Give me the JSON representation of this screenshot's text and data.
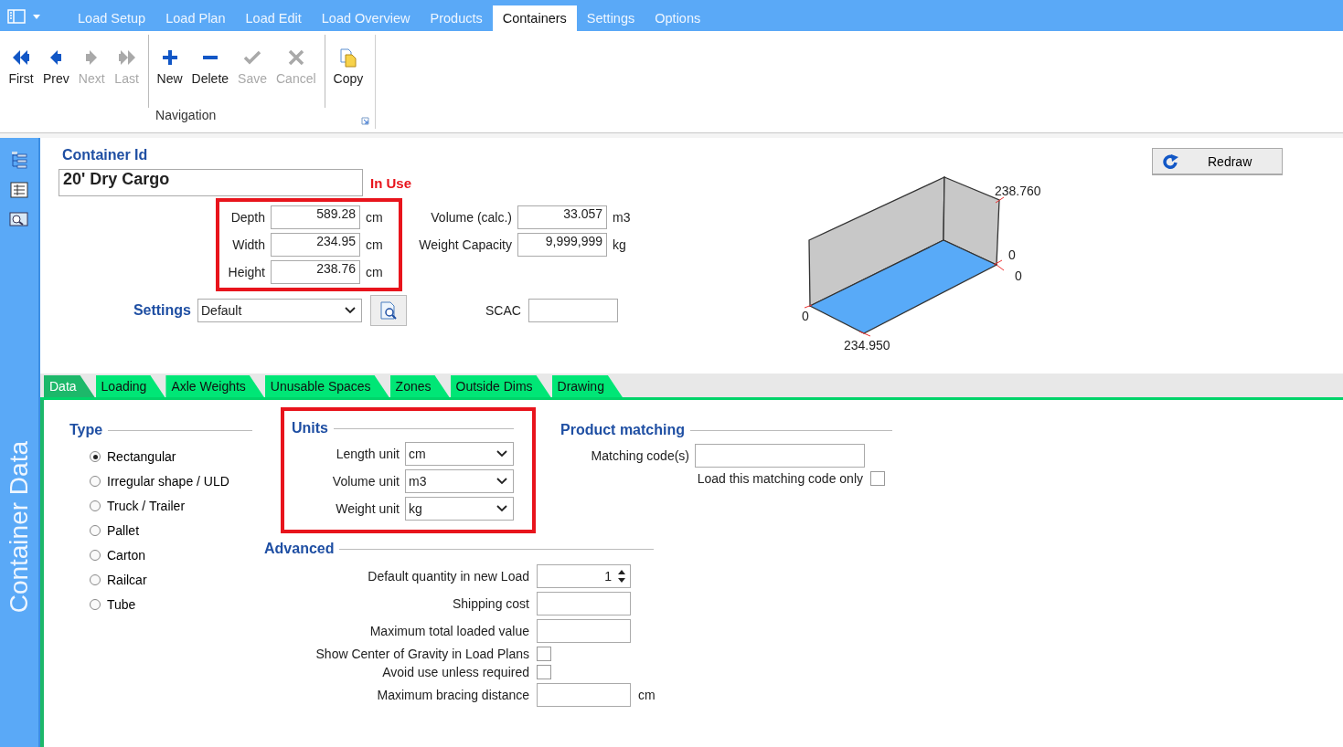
{
  "menu_tabs": [
    {
      "label": "Load Setup",
      "selected": false
    },
    {
      "label": "Load Plan",
      "selected": false
    },
    {
      "label": "Load Edit",
      "selected": false
    },
    {
      "label": "Load Overview",
      "selected": false
    },
    {
      "label": "Products",
      "selected": false
    },
    {
      "label": "Containers",
      "selected": true
    },
    {
      "label": "Settings",
      "selected": false
    },
    {
      "label": "Options",
      "selected": false
    }
  ],
  "ribbon": {
    "sections": [
      [
        {
          "kind": "first",
          "label": "First",
          "disabled": false
        },
        {
          "kind": "prev",
          "label": "Prev",
          "disabled": false
        },
        {
          "kind": "next",
          "label": "Next",
          "disabled": true
        },
        {
          "kind": "last",
          "label": "Last",
          "disabled": true
        }
      ],
      [
        {
          "kind": "new",
          "label": "New",
          "disabled": false
        },
        {
          "kind": "delete",
          "label": "Delete",
          "disabled": false
        },
        {
          "kind": "save",
          "label": "Save",
          "disabled": true
        },
        {
          "kind": "cancel",
          "label": "Cancel",
          "disabled": true
        }
      ],
      [
        {
          "kind": "copy",
          "label": "Copy",
          "disabled": false
        }
      ]
    ],
    "group_label": "Navigation"
  },
  "sidebar": {
    "title": "Container Data"
  },
  "container": {
    "id_label": "Container Id",
    "id": "20' Dry Cargo",
    "status": "In Use",
    "dimensions": {
      "highlighted": true,
      "rows": [
        {
          "label": "Depth",
          "value": "589.28",
          "unit": "cm"
        },
        {
          "label": "Width",
          "value": "234.95",
          "unit": "cm"
        },
        {
          "label": "Height",
          "value": "238.76",
          "unit": "cm"
        }
      ]
    },
    "metrics": [
      {
        "label": "Volume (calc.)",
        "value": "33.057",
        "unit": "m3"
      },
      {
        "label": "Weight Capacity",
        "value": "9,999,999",
        "unit": "kg"
      }
    ],
    "settings": {
      "label": "Settings",
      "value": "Default"
    },
    "scac": {
      "label": "SCAC"
    }
  },
  "drawing": {
    "height_label": "238.760",
    "corner_labels": [
      "0",
      "0",
      "0"
    ],
    "width_label": "234.950"
  },
  "redraw_button": "Redraw",
  "section_tabs": [
    {
      "label": "Data",
      "selected": true
    },
    {
      "label": "Loading",
      "selected": false
    },
    {
      "label": "Axle Weights",
      "selected": false
    },
    {
      "label": "Unusable Spaces",
      "selected": false
    },
    {
      "label": "Zones",
      "selected": false
    },
    {
      "label": "Outside Dims",
      "selected": false
    },
    {
      "label": "Drawing",
      "selected": false
    }
  ],
  "type_group": {
    "title": "Type",
    "options": [
      {
        "label": "Rectangular",
        "selected": true
      },
      {
        "label": "Irregular shape / ULD",
        "selected": false
      },
      {
        "label": "Truck / Trailer",
        "selected": false
      },
      {
        "label": "Pallet",
        "selected": false
      },
      {
        "label": "Carton",
        "selected": false
      },
      {
        "label": "Railcar",
        "selected": false
      },
      {
        "label": "Tube",
        "selected": false
      }
    ]
  },
  "units": {
    "title": "Units",
    "highlighted": true,
    "fields": [
      {
        "label": "Length unit",
        "value": "cm"
      },
      {
        "label": "Volume unit",
        "value": "m3"
      },
      {
        "label": "Weight unit",
        "value": "kg"
      }
    ]
  },
  "product_matching": {
    "title": "Product matching",
    "fields": [
      {
        "kind": "text",
        "label": "Matching code(s)"
      },
      {
        "kind": "checkbox",
        "label": "Load this matching code only",
        "checked": false
      }
    ]
  },
  "advanced": {
    "title": "Advanced",
    "fields": [
      {
        "kind": "spinner",
        "label": "Default quantity in new Load",
        "value": "1"
      },
      {
        "kind": "text",
        "label": "Shipping cost"
      },
      {
        "kind": "text",
        "label": "Maximum total loaded value"
      },
      {
        "kind": "checkbox",
        "label": "Show Center of Gravity in Load Plans",
        "checked": false
      },
      {
        "kind": "checkbox",
        "label": "Avoid use unless required",
        "checked": false
      },
      {
        "kind": "text",
        "label": "Maximum bracing distance",
        "unit": "cm"
      }
    ]
  }
}
